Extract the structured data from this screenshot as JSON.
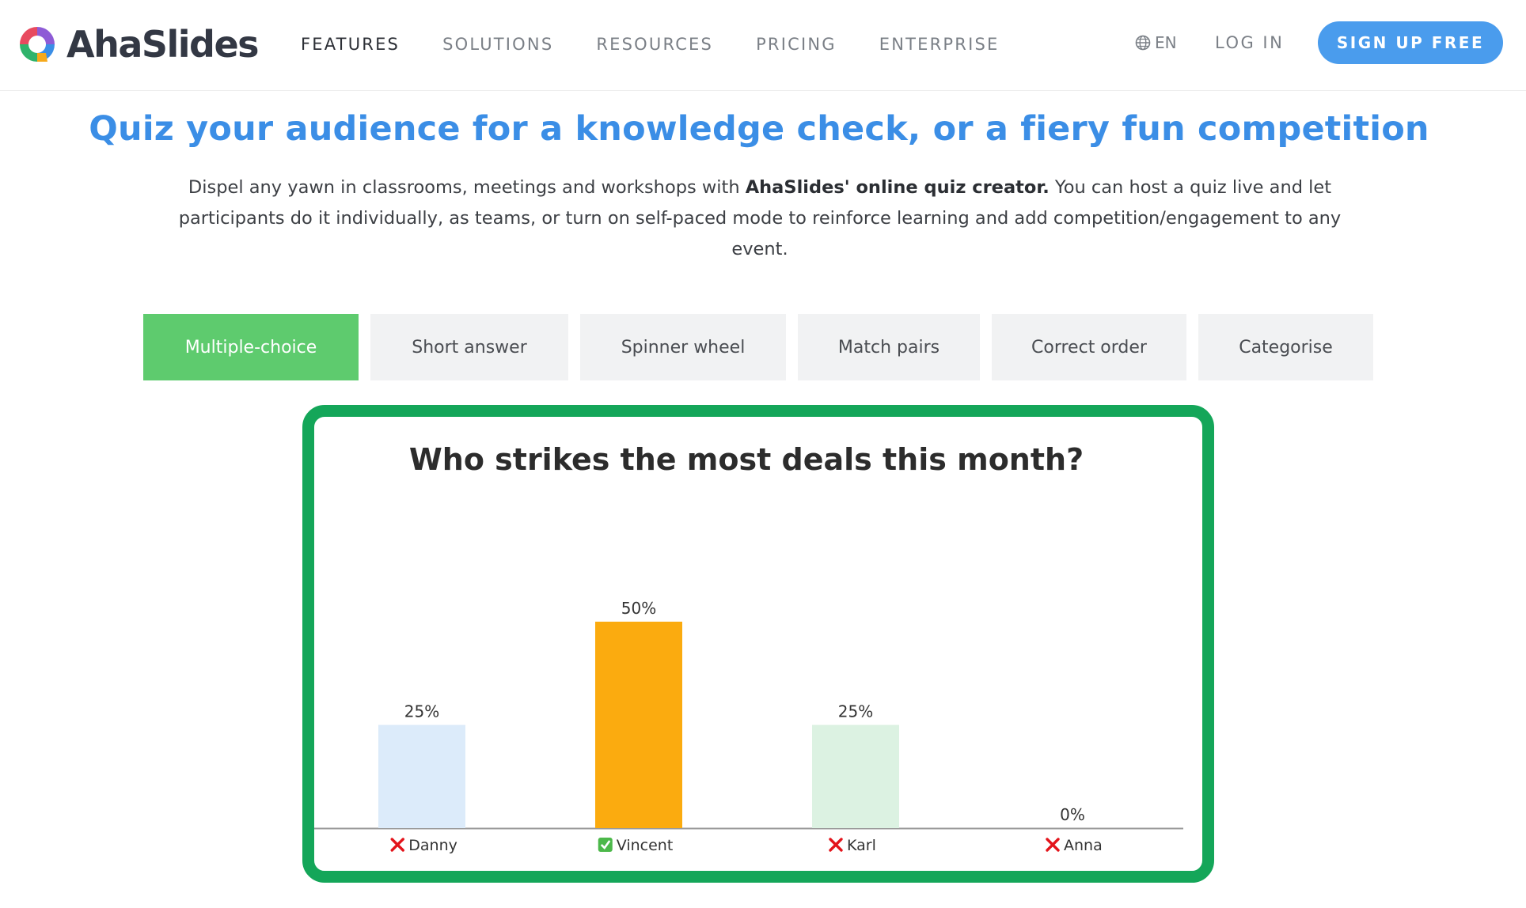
{
  "brand": {
    "name": "AhaSlides",
    "logo_colors": [
      "#e84a5f",
      "#8e5bd6",
      "#3b8ee6",
      "#2fb36b",
      "#f6a91b"
    ]
  },
  "nav": {
    "items": [
      {
        "label": "FEATURES",
        "active": true
      },
      {
        "label": "SOLUTIONS",
        "active": false
      },
      {
        "label": "RESOURCES",
        "active": false
      },
      {
        "label": "PRICING",
        "active": false
      },
      {
        "label": "ENTERPRISE",
        "active": false
      }
    ],
    "language": "EN",
    "login_label": "LOG IN",
    "signup_label": "SIGN UP FREE"
  },
  "hero": {
    "title": "Quiz your audience for a knowledge check, or a fiery fun competition",
    "desc_before": "Dispel any yawn in classrooms, meetings and workshops with ",
    "desc_bold": "AhaSlides' online quiz creator.",
    "desc_after": " You can host a quiz live and let participants do it individually, as teams, or turn on self-paced mode to reinforce learning and add competition/engagement to any event."
  },
  "tabs": [
    {
      "label": "Multiple-choice",
      "active": true
    },
    {
      "label": "Short answer",
      "active": false
    },
    {
      "label": "Spinner wheel",
      "active": false
    },
    {
      "label": "Match pairs",
      "active": false
    },
    {
      "label": "Correct order",
      "active": false
    },
    {
      "label": "Categorise",
      "active": false
    }
  ],
  "colors": {
    "accent_blue": "#4a9ced",
    "title_blue": "#3b8ee6",
    "tab_active": "#5ecb6e",
    "card_border": "#14a659"
  },
  "chart_data": {
    "type": "bar",
    "title": "Who strikes the most deals this month?",
    "categories": [
      "Danny",
      "Vincent",
      "Karl",
      "Anna"
    ],
    "values": [
      25,
      50,
      25,
      0
    ],
    "value_labels": [
      "25%",
      "50%",
      "25%",
      "0%"
    ],
    "correct": [
      false,
      true,
      false,
      false
    ],
    "markers": [
      "cross-icon",
      "check-icon",
      "cross-icon",
      "cross-icon"
    ],
    "bar_colors": [
      "#dcebfa",
      "#fbab0f",
      "#dcf2e2",
      "#e9e9e9"
    ],
    "ylim": [
      0,
      50
    ],
    "xlabel": "",
    "ylabel": "",
    "grid": false,
    "legend": "none"
  }
}
